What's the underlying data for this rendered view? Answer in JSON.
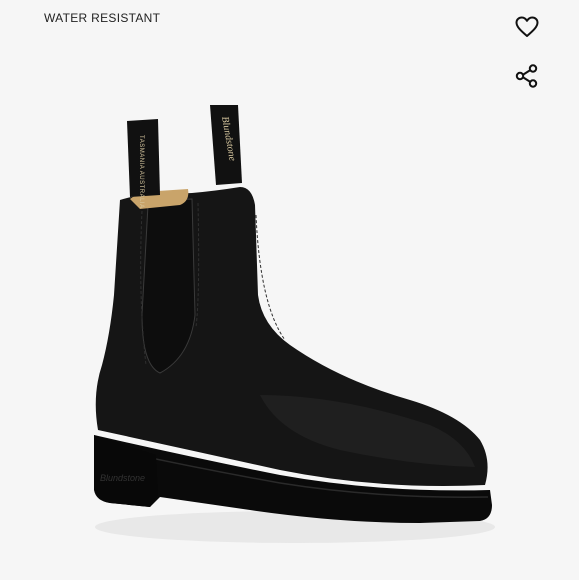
{
  "product": {
    "badge_label": "WATER RESISTANT",
    "pull_tab_left_text": "TASMANIA AUSTRALIA",
    "pull_tab_right_text": "Blundstone",
    "sole_logo_text": "Blundstone"
  },
  "actions": {
    "wishlist_icon": "heart-icon",
    "share_icon": "share-icon"
  },
  "colors": {
    "background": "#f6f6f6",
    "leather": "#141414",
    "lining": "#c9a46a",
    "icon": "#111111"
  }
}
